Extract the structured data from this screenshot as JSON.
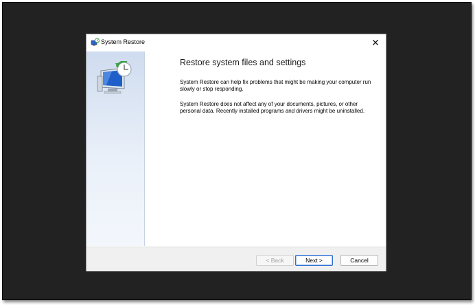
{
  "window": {
    "title": "System Restore",
    "close_glyph": "✕"
  },
  "wizard": {
    "heading": "Restore system files and settings",
    "paragraph1": "System Restore can help fix problems that might be making your computer run slowly or stop responding.",
    "paragraph2": "System Restore does not affect any of your documents, pictures, or other personal data. Recently installed programs and drivers might be uninstalled."
  },
  "buttons": {
    "back": "< Back",
    "next": "Next >",
    "cancel": "Cancel"
  },
  "icons": {
    "app": "system-restore-icon",
    "sidebar": "system-restore-graphic"
  },
  "colors": {
    "accent": "#2f6fd0",
    "sidebar_top": "#cfdcef",
    "frame": "#222222"
  }
}
